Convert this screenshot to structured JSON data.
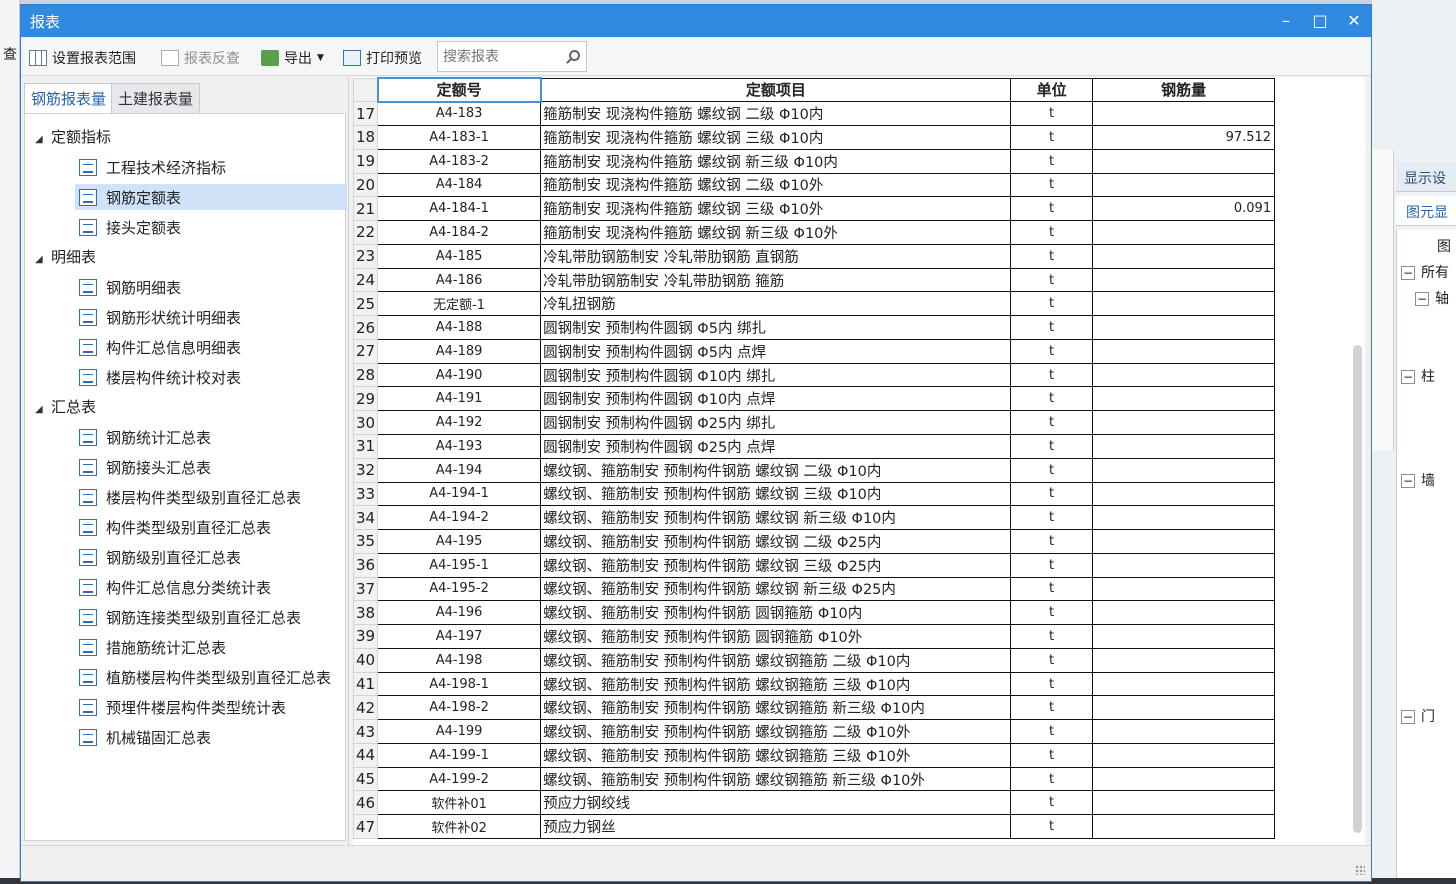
{
  "window": {
    "title": "报表"
  },
  "toolbar": {
    "set_range": "设置报表范围",
    "reverse_check": "报表反查",
    "export": "导出",
    "print_preview": "打印预览",
    "search_placeholder": "搜索报表"
  },
  "tabs": [
    "钢筋报表量",
    "土建报表量"
  ],
  "tree": [
    {
      "label": "定额指标",
      "children": [
        "工程技术经济指标",
        "钢筋定额表",
        "接头定额表"
      ]
    },
    {
      "label": "明细表",
      "children": [
        "钢筋明细表",
        "钢筋形状统计明细表",
        "构件汇总信息明细表",
        "楼层构件统计校对表"
      ]
    },
    {
      "label": "汇总表",
      "children": [
        "钢筋统计汇总表",
        "钢筋接头汇总表",
        "楼层构件类型级别直径汇总表",
        "构件类型级别直径汇总表",
        "钢筋级别直径汇总表",
        "构件汇总信息分类统计表",
        "钢筋连接类型级别直径汇总表",
        "措施筋统计汇总表",
        "植筋楼层构件类型级别直径汇总表",
        "预埋件楼层构件类型统计表",
        "机械锚固汇总表"
      ]
    }
  ],
  "selected_item": "钢筋定额表",
  "table": {
    "columns": [
      "定额号",
      "定额项目",
      "单位",
      "钢筋量"
    ],
    "rows": [
      {
        "n": "17",
        "code": "A4-183",
        "item": "箍筋制安 现浇构件箍筋 螺纹钢 二级 Φ10内",
        "unit": "t",
        "qty": ""
      },
      {
        "n": "18",
        "code": "A4-183-1",
        "item": "箍筋制安 现浇构件箍筋 螺纹钢  三级 Φ10内",
        "unit": "t",
        "qty": "97.512"
      },
      {
        "n": "19",
        "code": "A4-183-2",
        "item": "箍筋制安 现浇构件箍筋 螺纹钢  新三级 Φ10内",
        "unit": "t",
        "qty": ""
      },
      {
        "n": "20",
        "code": "A4-184",
        "item": "箍筋制安 现浇构件箍筋 螺纹钢 二级 Φ10外",
        "unit": "t",
        "qty": ""
      },
      {
        "n": "21",
        "code": "A4-184-1",
        "item": "箍筋制安 现浇构件箍筋 螺纹钢 三级 Φ10外",
        "unit": "t",
        "qty": "0.091"
      },
      {
        "n": "22",
        "code": "A4-184-2",
        "item": "箍筋制安 现浇构件箍筋 螺纹钢 新三级 Φ10外",
        "unit": "t",
        "qty": ""
      },
      {
        "n": "23",
        "code": "A4-185",
        "item": "冷轧带肋钢筋制安 冷轧带肋钢筋 直钢筋",
        "unit": "t",
        "qty": ""
      },
      {
        "n": "24",
        "code": "A4-186",
        "item": "冷轧带肋钢筋制安 冷轧带肋钢筋 箍筋",
        "unit": "t",
        "qty": ""
      },
      {
        "n": "25",
        "code": "无定额-1",
        "item": "冷轧扭钢筋",
        "unit": "t",
        "qty": ""
      },
      {
        "n": "26",
        "code": "A4-188",
        "item": "圆钢制安 预制构件圆钢 Φ5内 绑扎",
        "unit": "t",
        "qty": ""
      },
      {
        "n": "27",
        "code": "A4-189",
        "item": "圆钢制安 预制构件圆钢 Φ5内 点焊",
        "unit": "t",
        "qty": ""
      },
      {
        "n": "28",
        "code": "A4-190",
        "item": "圆钢制安 预制构件圆钢 Φ10内 绑扎",
        "unit": "t",
        "qty": ""
      },
      {
        "n": "29",
        "code": "A4-191",
        "item": "圆钢制安 预制构件圆钢 Φ10内 点焊",
        "unit": "t",
        "qty": ""
      },
      {
        "n": "30",
        "code": "A4-192",
        "item": "圆钢制安 预制构件圆钢 Φ25内 绑扎",
        "unit": "t",
        "qty": ""
      },
      {
        "n": "31",
        "code": "A4-193",
        "item": "圆钢制安 预制构件圆钢 Φ25内 点焊",
        "unit": "t",
        "qty": ""
      },
      {
        "n": "32",
        "code": "A4-194",
        "item": "螺纹钢、箍筋制安 预制构件钢筋 螺纹钢 二级 Φ10内",
        "unit": "t",
        "qty": ""
      },
      {
        "n": "33",
        "code": "A4-194-1",
        "item": "螺纹钢、箍筋制安 预制构件钢筋 螺纹钢 三级 Φ10内",
        "unit": "t",
        "qty": ""
      },
      {
        "n": "34",
        "code": "A4-194-2",
        "item": "螺纹钢、箍筋制安 预制构件钢筋 螺纹钢 新三级 Φ10内",
        "unit": "t",
        "qty": ""
      },
      {
        "n": "35",
        "code": "A4-195",
        "item": "螺纹钢、箍筋制安 预制构件钢筋 螺纹钢 二级 Φ25内",
        "unit": "t",
        "qty": ""
      },
      {
        "n": "36",
        "code": "A4-195-1",
        "item": "螺纹钢、箍筋制安 预制构件钢筋 螺纹钢 三级 Φ25内",
        "unit": "t",
        "qty": ""
      },
      {
        "n": "37",
        "code": "A4-195-2",
        "item": "螺纹钢、箍筋制安 预制构件钢筋 螺纹钢 新三级 Φ25内",
        "unit": "t",
        "qty": ""
      },
      {
        "n": "38",
        "code": "A4-196",
        "item": "螺纹钢、箍筋制安 预制构件钢筋 圆钢箍筋 Φ10内",
        "unit": "t",
        "qty": ""
      },
      {
        "n": "39",
        "code": "A4-197",
        "item": "螺纹钢、箍筋制安 预制构件钢筋 圆钢箍筋 Φ10外",
        "unit": "t",
        "qty": ""
      },
      {
        "n": "40",
        "code": "A4-198",
        "item": "螺纹钢、箍筋制安 预制构件钢筋 螺纹钢箍筋 二级 Φ10内",
        "unit": "t",
        "qty": ""
      },
      {
        "n": "41",
        "code": "A4-198-1",
        "item": "螺纹钢、箍筋制安 预制构件钢筋 螺纹钢箍筋 三级 Φ10内",
        "unit": "t",
        "qty": ""
      },
      {
        "n": "42",
        "code": "A4-198-2",
        "item": "螺纹钢、箍筋制安 预制构件钢筋 螺纹钢箍筋 新三级 Φ10内",
        "unit": "t",
        "qty": ""
      },
      {
        "n": "43",
        "code": "A4-199",
        "item": "螺纹钢、箍筋制安 预制构件钢筋 螺纹钢箍筋 二级 Φ10外",
        "unit": "t",
        "qty": ""
      },
      {
        "n": "44",
        "code": "A4-199-1",
        "item": "螺纹钢、箍筋制安 预制构件钢筋 螺纹钢箍筋 三级 Φ10外",
        "unit": "t",
        "qty": ""
      },
      {
        "n": "45",
        "code": "A4-199-2",
        "item": "螺纹钢、箍筋制安 预制构件钢筋 螺纹钢箍筋 新三级 Φ10外",
        "unit": "t",
        "qty": ""
      },
      {
        "n": "46",
        "code": "软件补01",
        "item": "预应力钢绞线",
        "unit": "t",
        "qty": ""
      },
      {
        "n": "47",
        "code": "软件补02",
        "item": "预应力钢丝",
        "unit": "t",
        "qty": ""
      }
    ]
  },
  "background": {
    "left_letter": "查",
    "right_panel_title": "显示设",
    "right_panel_tab": "图元显",
    "right_tree_header": "图",
    "right_tree": [
      "所有",
      "轴",
      "柱",
      "墙",
      "门"
    ]
  },
  "colors": {
    "titlebar": "#2f8ae0",
    "selection": "#cfe2f7",
    "tab_active_text": "#2a63b0"
  }
}
